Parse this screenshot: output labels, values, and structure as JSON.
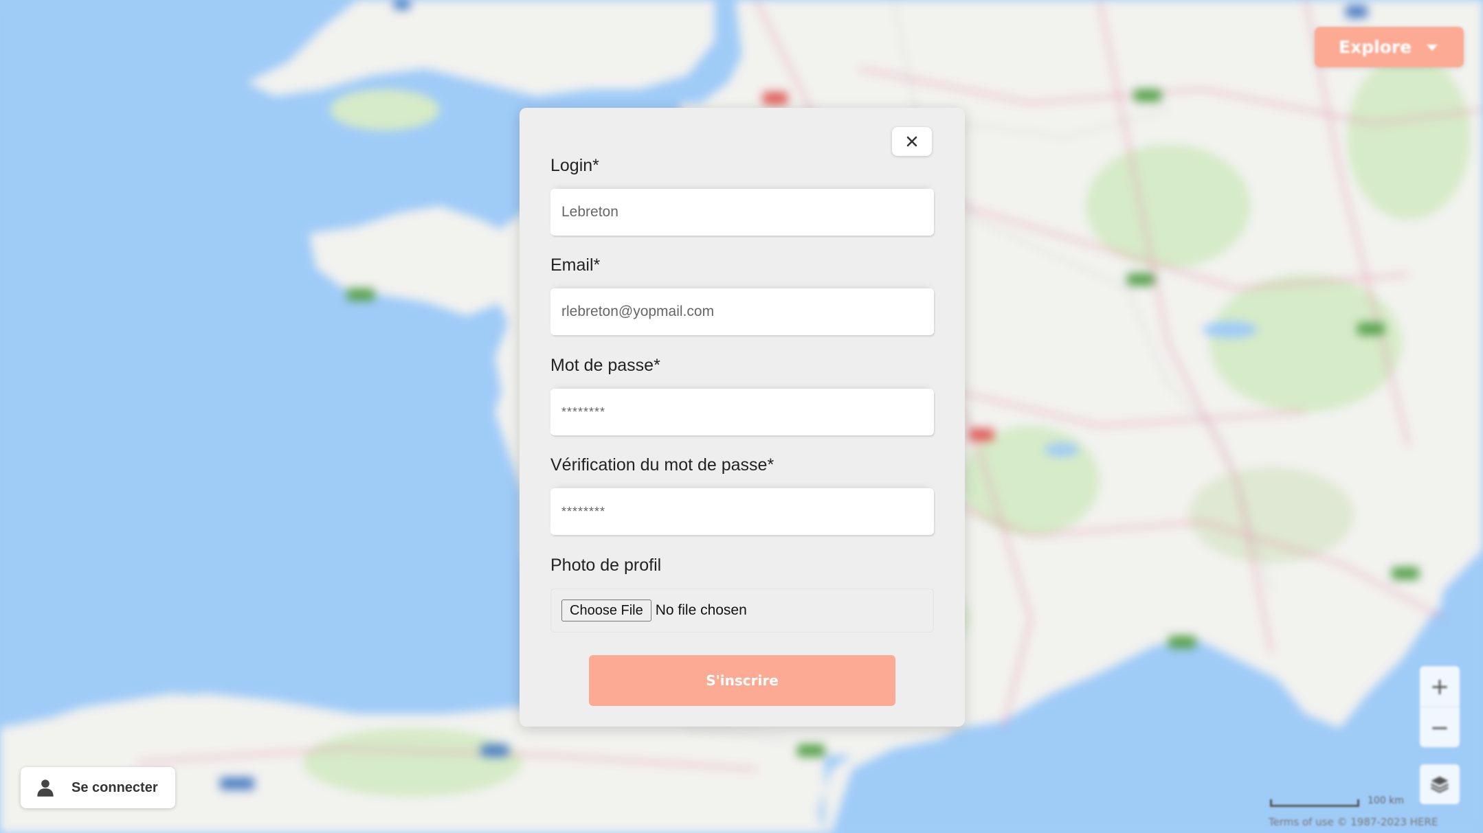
{
  "header": {
    "explore_label": "Explore"
  },
  "map": {
    "attribution": "Terms of use   © 1987-2023 HERE",
    "scale_label": "100 km",
    "zoom_in": "+",
    "zoom_out": "−"
  },
  "signup_form": {
    "login_label": "Login*",
    "login_value": "Lebreton",
    "email_label": "Email*",
    "email_value": "rlebreton@yopmail.com",
    "password_label": "Mot de passe*",
    "password_value": "********",
    "password_confirm_label": "Vérification du mot de passe*",
    "password_confirm_value": "********",
    "photo_label": "Photo de profil",
    "choose_file_label": "Choose File",
    "no_file_text": "No file chosen",
    "submit_label": "S'inscrire",
    "close_symbol": "✕"
  },
  "auth": {
    "connect_label": "Se connecter"
  },
  "colors": {
    "accent": "#fcaa94",
    "modal_bg": "#eeeeee",
    "sea": "#9fcbf7",
    "land": "#f2f2ef"
  }
}
